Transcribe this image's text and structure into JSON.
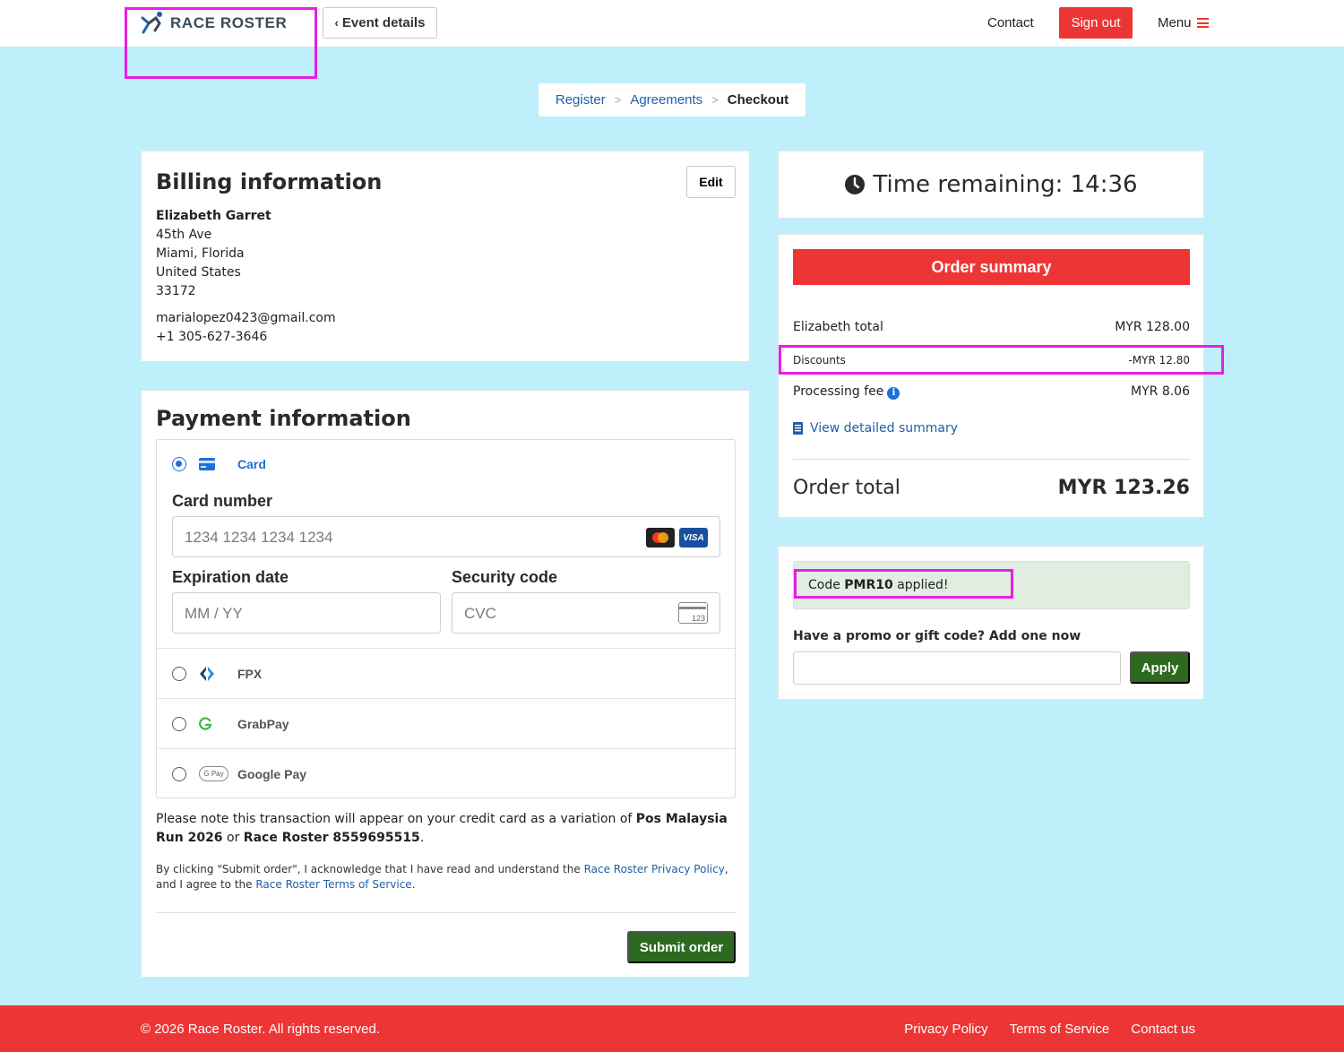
{
  "header": {
    "logo_text": "RACE ROSTER",
    "event_details_label": "Event details",
    "contact_label": "Contact",
    "sign_out_label": "Sign out",
    "menu_label": "Menu"
  },
  "breadcrumb": {
    "items": [
      "Register",
      "Agreements",
      "Checkout"
    ],
    "separator": ">"
  },
  "billing": {
    "title": "Billing information",
    "edit_label": "Edit",
    "name": "Elizabeth Garret",
    "address_lines": [
      "45th Ave",
      "Miami, Florida",
      "United States",
      "33172"
    ],
    "email": "marialopez0423@gmail.com",
    "phone": "+1 305-627-3646"
  },
  "payment": {
    "title": "Payment information",
    "methods": [
      {
        "label": "Card",
        "icon": "credit-card-icon",
        "selected": true
      },
      {
        "label": "FPX",
        "icon": "fpx-icon",
        "selected": false
      },
      {
        "label": "GrabPay",
        "icon": "grabpay-icon",
        "selected": false
      },
      {
        "label": "Google Pay",
        "icon": "google-pay-icon",
        "selected": false
      }
    ],
    "card_number_label": "Card number",
    "card_number_placeholder": "1234 1234 1234 1234",
    "expiration_label": "Expiration date",
    "expiration_placeholder": "MM / YY",
    "security_label": "Security code",
    "security_placeholder": "CVC",
    "cvc_icon_text": "123",
    "google_pay_badge": "G Pay",
    "visa_badge": "VISA",
    "note_prefix": "Please note this transaction will appear on your credit card as a variation of ",
    "note_bold1": "Pos Malaysia Run 2026",
    "note_mid": " or ",
    "note_bold2": "Race Roster 8559695515",
    "note_suffix": ".",
    "legal_prefix": "By clicking \"Submit order\", I acknowledge that I have read and understand the ",
    "privacy_link": "Race Roster Privacy Policy",
    "legal_mid": ", and I agree to the ",
    "terms_link": "Race Roster Terms of Service",
    "legal_suffix": ".",
    "submit_label": "Submit order"
  },
  "timer": {
    "text": "Time remaining: 14:36"
  },
  "summary": {
    "title": "Order summary",
    "rows": [
      {
        "label": "Elizabeth total",
        "amount": "MYR 128.00"
      },
      {
        "label": "Discounts",
        "amount": "-MYR 12.80"
      },
      {
        "label": "Processing fee",
        "amount": "MYR 8.06"
      }
    ],
    "view_detailed_label": "View detailed summary",
    "order_total_label": "Order total",
    "order_total_amount": "MYR 123.26"
  },
  "promo": {
    "applied_prefix": "Code ",
    "applied_code": "PMR10",
    "applied_suffix": " applied!",
    "prompt": "Have a promo or gift code? Add one now",
    "input_value": "",
    "apply_label": "Apply"
  },
  "footer": {
    "copyright": "© 2026 Race Roster. All rights reserved.",
    "links": [
      "Privacy Policy",
      "Terms of Service",
      "Contact us"
    ]
  },
  "colors": {
    "page_bg": "#bfeffa",
    "brand_red": "#ee3535",
    "action_green": "#2d6a1f",
    "link_blue": "#1f5fa8",
    "annotation_magenta": "#e81fe0"
  }
}
